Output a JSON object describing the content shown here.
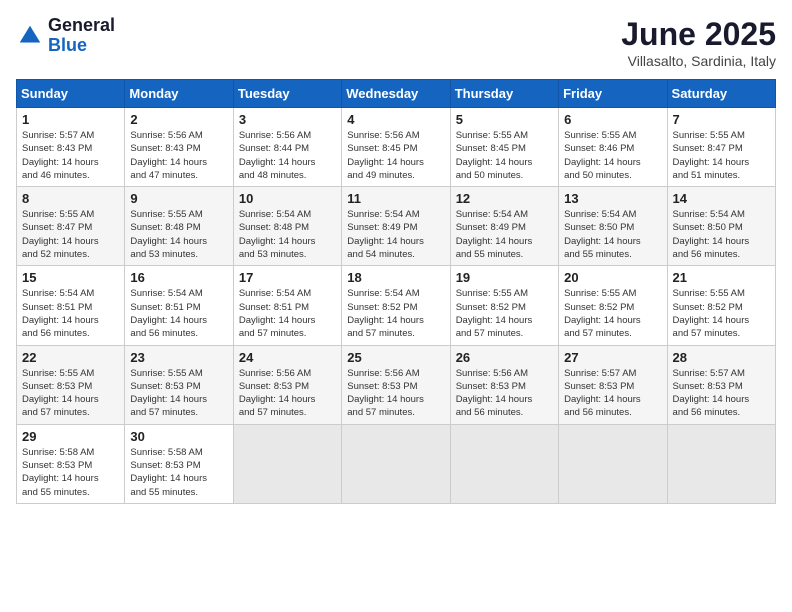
{
  "header": {
    "logo_general": "General",
    "logo_blue": "Blue",
    "month_title": "June 2025",
    "location": "Villasalto, Sardinia, Italy"
  },
  "weekdays": [
    "Sunday",
    "Monday",
    "Tuesday",
    "Wednesday",
    "Thursday",
    "Friday",
    "Saturday"
  ],
  "weeks": [
    [
      {
        "day": "1",
        "sunrise": "5:57 AM",
        "sunset": "8:43 PM",
        "daylight": "14 hours and 46 minutes."
      },
      {
        "day": "2",
        "sunrise": "5:56 AM",
        "sunset": "8:43 PM",
        "daylight": "14 hours and 47 minutes."
      },
      {
        "day": "3",
        "sunrise": "5:56 AM",
        "sunset": "8:44 PM",
        "daylight": "14 hours and 48 minutes."
      },
      {
        "day": "4",
        "sunrise": "5:56 AM",
        "sunset": "8:45 PM",
        "daylight": "14 hours and 49 minutes."
      },
      {
        "day": "5",
        "sunrise": "5:55 AM",
        "sunset": "8:45 PM",
        "daylight": "14 hours and 50 minutes."
      },
      {
        "day": "6",
        "sunrise": "5:55 AM",
        "sunset": "8:46 PM",
        "daylight": "14 hours and 50 minutes."
      },
      {
        "day": "7",
        "sunrise": "5:55 AM",
        "sunset": "8:47 PM",
        "daylight": "14 hours and 51 minutes."
      }
    ],
    [
      {
        "day": "8",
        "sunrise": "5:55 AM",
        "sunset": "8:47 PM",
        "daylight": "14 hours and 52 minutes."
      },
      {
        "day": "9",
        "sunrise": "5:55 AM",
        "sunset": "8:48 PM",
        "daylight": "14 hours and 53 minutes."
      },
      {
        "day": "10",
        "sunrise": "5:54 AM",
        "sunset": "8:48 PM",
        "daylight": "14 hours and 53 minutes."
      },
      {
        "day": "11",
        "sunrise": "5:54 AM",
        "sunset": "8:49 PM",
        "daylight": "14 hours and 54 minutes."
      },
      {
        "day": "12",
        "sunrise": "5:54 AM",
        "sunset": "8:49 PM",
        "daylight": "14 hours and 55 minutes."
      },
      {
        "day": "13",
        "sunrise": "5:54 AM",
        "sunset": "8:50 PM",
        "daylight": "14 hours and 55 minutes."
      },
      {
        "day": "14",
        "sunrise": "5:54 AM",
        "sunset": "8:50 PM",
        "daylight": "14 hours and 56 minutes."
      }
    ],
    [
      {
        "day": "15",
        "sunrise": "5:54 AM",
        "sunset": "8:51 PM",
        "daylight": "14 hours and 56 minutes."
      },
      {
        "day": "16",
        "sunrise": "5:54 AM",
        "sunset": "8:51 PM",
        "daylight": "14 hours and 56 minutes."
      },
      {
        "day": "17",
        "sunrise": "5:54 AM",
        "sunset": "8:51 PM",
        "daylight": "14 hours and 57 minutes."
      },
      {
        "day": "18",
        "sunrise": "5:54 AM",
        "sunset": "8:52 PM",
        "daylight": "14 hours and 57 minutes."
      },
      {
        "day": "19",
        "sunrise": "5:55 AM",
        "sunset": "8:52 PM",
        "daylight": "14 hours and 57 minutes."
      },
      {
        "day": "20",
        "sunrise": "5:55 AM",
        "sunset": "8:52 PM",
        "daylight": "14 hours and 57 minutes."
      },
      {
        "day": "21",
        "sunrise": "5:55 AM",
        "sunset": "8:52 PM",
        "daylight": "14 hours and 57 minutes."
      }
    ],
    [
      {
        "day": "22",
        "sunrise": "5:55 AM",
        "sunset": "8:53 PM",
        "daylight": "14 hours and 57 minutes."
      },
      {
        "day": "23",
        "sunrise": "5:55 AM",
        "sunset": "8:53 PM",
        "daylight": "14 hours and 57 minutes."
      },
      {
        "day": "24",
        "sunrise": "5:56 AM",
        "sunset": "8:53 PM",
        "daylight": "14 hours and 57 minutes."
      },
      {
        "day": "25",
        "sunrise": "5:56 AM",
        "sunset": "8:53 PM",
        "daylight": "14 hours and 57 minutes."
      },
      {
        "day": "26",
        "sunrise": "5:56 AM",
        "sunset": "8:53 PM",
        "daylight": "14 hours and 56 minutes."
      },
      {
        "day": "27",
        "sunrise": "5:57 AM",
        "sunset": "8:53 PM",
        "daylight": "14 hours and 56 minutes."
      },
      {
        "day": "28",
        "sunrise": "5:57 AM",
        "sunset": "8:53 PM",
        "daylight": "14 hours and 56 minutes."
      }
    ],
    [
      {
        "day": "29",
        "sunrise": "5:58 AM",
        "sunset": "8:53 PM",
        "daylight": "14 hours and 55 minutes."
      },
      {
        "day": "30",
        "sunrise": "5:58 AM",
        "sunset": "8:53 PM",
        "daylight": "14 hours and 55 minutes."
      },
      null,
      null,
      null,
      null,
      null
    ]
  ],
  "labels": {
    "sunrise": "Sunrise: ",
    "sunset": "Sunset: ",
    "daylight": "Daylight: "
  }
}
